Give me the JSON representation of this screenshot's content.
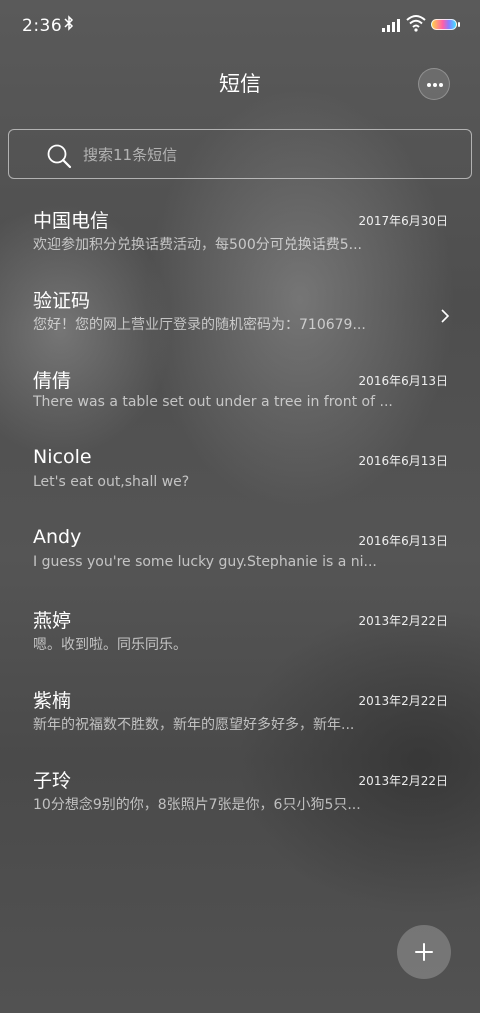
{
  "status_bar": {
    "time": "2:36",
    "bluetooth_icon": "bluetooth-icon",
    "signal_icon": "signal-icon",
    "wifi_icon": "wifi-icon",
    "battery_icon": "battery-icon"
  },
  "header": {
    "title": "短信",
    "more_icon": "more-horizontal-icon"
  },
  "search": {
    "placeholder": "搜索11条短信",
    "icon": "search-icon"
  },
  "conversations": [
    {
      "name": "中国电信",
      "date": "2017年6月30日",
      "preview": "欢迎参加积分兑换话费活动，每500分可兑换话费5..."
    },
    {
      "name": "验证码",
      "date": "",
      "preview": "您好！您的网上营业厅登录的随机密码为：710679...",
      "chevron": true
    },
    {
      "name": "倩倩",
      "date": "2016年6月13日",
      "preview": "There was a table set out under a tree in front of ..."
    },
    {
      "name": "Nicole",
      "date": "2016年6月13日",
      "preview": "Let's eat out,shall we?"
    },
    {
      "name": "Andy",
      "date": "2016年6月13日",
      "preview": "I guess you're some lucky guy.Stephanie is a ni..."
    },
    {
      "name": "燕婷",
      "date": "2013年2月22日",
      "preview": "嗯。收到啦。同乐同乐。"
    },
    {
      "name": "紫楠",
      "date": "2013年2月22日",
      "preview": "新年的祝福数不胜数，新年的愿望好多好多，新年..."
    },
    {
      "name": "子玲",
      "date": "2013年2月22日",
      "preview": "10分想念9别的你，8张照片7张是你，6只小狗5只..."
    }
  ],
  "fab": {
    "icon": "plus-icon"
  }
}
